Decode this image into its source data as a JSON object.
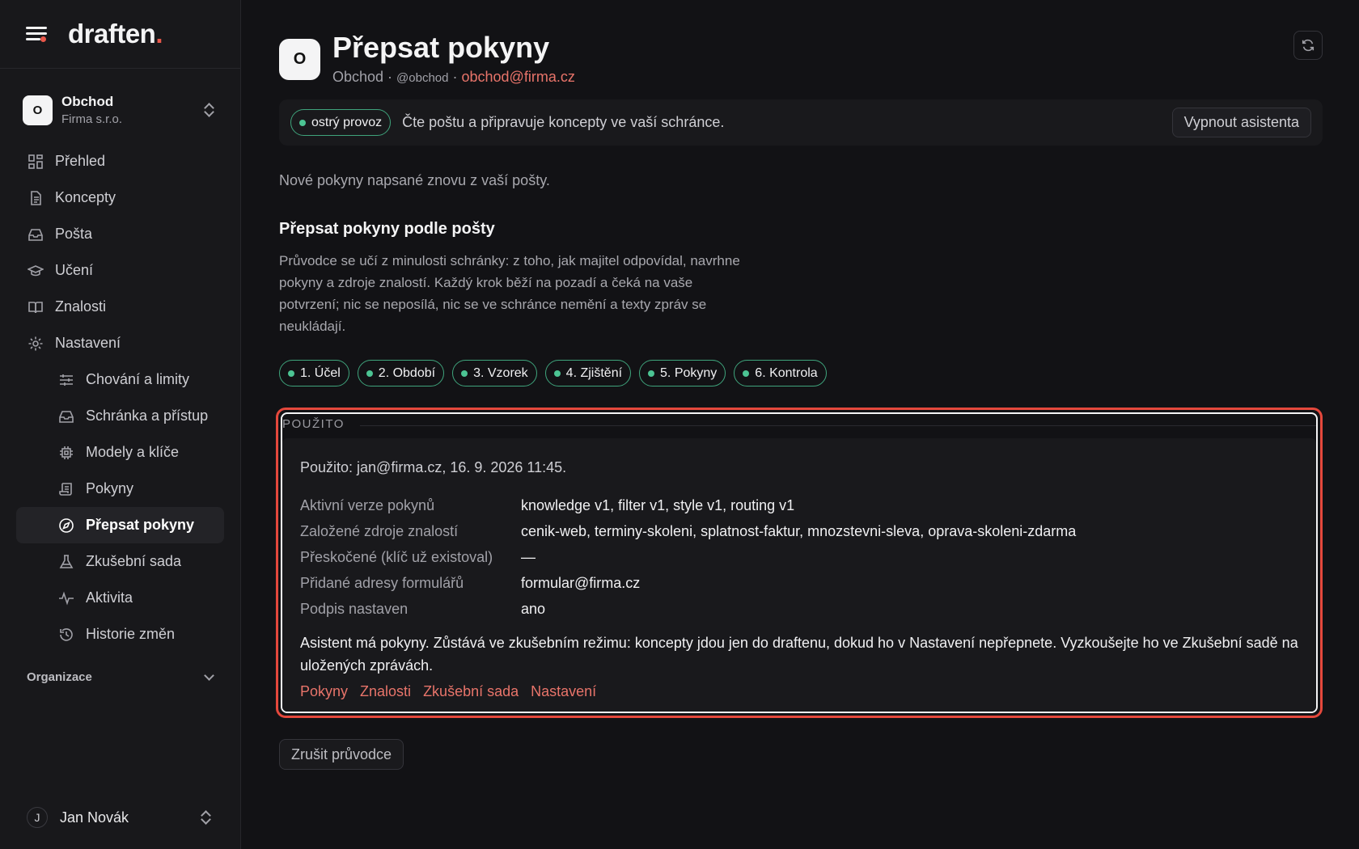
{
  "brand": {
    "name": "draften",
    "dot": "."
  },
  "workspace": {
    "initial": "O",
    "name": "Obchod",
    "org": "Firma s.r.o."
  },
  "nav": [
    {
      "label": "Přehled",
      "icon": "dashboard-icon"
    },
    {
      "label": "Koncepty",
      "icon": "document-icon"
    },
    {
      "label": "Pošta",
      "icon": "inbox-icon"
    },
    {
      "label": "Učení",
      "icon": "graduation-cap-icon"
    },
    {
      "label": "Znalosti",
      "icon": "book-icon"
    },
    {
      "label": "Nastavení",
      "icon": "gear-icon"
    }
  ],
  "subnav": [
    {
      "label": "Chování a limity",
      "icon": "sliders-icon"
    },
    {
      "label": "Schránka a přístup",
      "icon": "inbox-icon"
    },
    {
      "label": "Modely a klíče",
      "icon": "chip-icon"
    },
    {
      "label": "Pokyny",
      "icon": "scroll-icon"
    },
    {
      "label": "Přepsat pokyny",
      "icon": "compass-icon",
      "active": true
    },
    {
      "label": "Zkušební sada",
      "icon": "flask-icon"
    },
    {
      "label": "Aktivita",
      "icon": "activity-icon"
    },
    {
      "label": "Historie změn",
      "icon": "history-icon"
    }
  ],
  "org_section": "Organizace",
  "user": {
    "initial": "J",
    "name": "Jan Novák"
  },
  "header": {
    "initial": "O",
    "title": "Přepsat pokyny",
    "mailbox": "Obchod",
    "sep1": " · ",
    "handle": "@obchod",
    "sep2": " · ",
    "email": "obchod@firma.cz"
  },
  "status": {
    "pill": "ostrý provoz",
    "text": "Čte poštu a připravuje koncepty ve vaší schránce.",
    "button": "Vypnout asistenta"
  },
  "intro": "Nové pokyny napsané znovu z vaší pošty.",
  "section": {
    "title": "Přepsat pokyny podle pošty",
    "desc": "Průvodce se učí z minulosti schránky: z toho, jak majitel odpovídal, navrhne pokyny a zdroje znalostí. Každý krok běží na pozadí a čeká na vaše potvrzení; nic se neposílá, nic se ve schránce nemění a texty zpráv se neukládají."
  },
  "steps": [
    "1. Účel",
    "2. Období",
    "3. Vzorek",
    "4. Zjištění",
    "5. Pokyny",
    "6. Kontrola"
  ],
  "result": {
    "legend": "POUŽITO",
    "used": "Použito: jan@firma.cz, 16. 9. 2026 11:45.",
    "rows": [
      {
        "k": "Aktivní verze pokynů",
        "v": "knowledge v1, filter v1, style v1, routing v1"
      },
      {
        "k": "Založené zdroje znalostí",
        "v": "cenik-web, terminy-skoleni, splatnost-faktur, mnozstevni-sleva, oprava-skoleni-zdarma"
      },
      {
        "k": "Přeskočené (klíč už existoval)",
        "v": "—"
      },
      {
        "k": "Přidané adresy formulářů",
        "v": "formular@firma.cz"
      },
      {
        "k": "Podpis nastaven",
        "v": "ano"
      }
    ],
    "message": "Asistent má pokyny. Zůstává ve zkušebním režimu: koncepty jdou jen do draftenu, dokud ho v Nastavení nepřepnete. Vyzkoušejte ho ve Zkušební sadě na uložených zprávách.",
    "links": [
      "Pokyny",
      "Znalosti",
      "Zkušební sada",
      "Nastavení"
    ]
  },
  "cancel": "Zrušit průvodce",
  "colors": {
    "accent": "#e8574a",
    "link": "#e8746a",
    "success": "#4cc493",
    "highlight": "#e5483c"
  }
}
